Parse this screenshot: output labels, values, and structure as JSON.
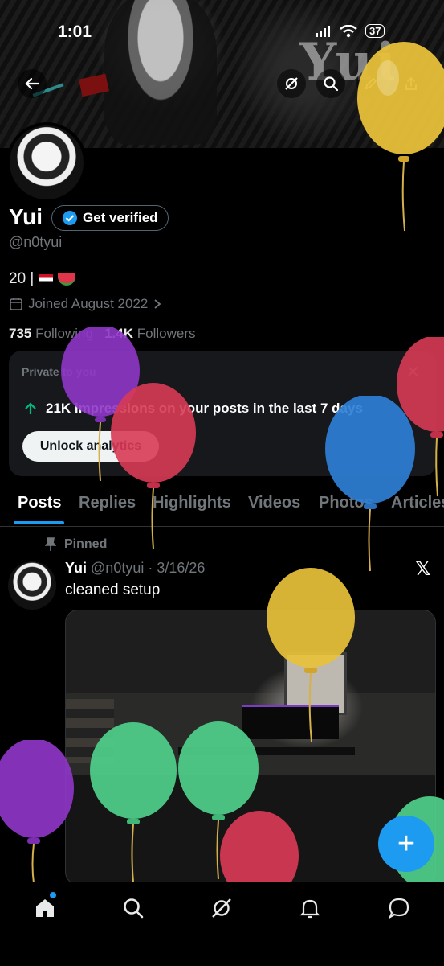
{
  "status_bar": {
    "time": "1:01",
    "battery": "37"
  },
  "banner": {
    "title": "Yui"
  },
  "profile": {
    "name": "Yui",
    "verify_label": "Get verified",
    "handle": "@n0tyui",
    "bio_text": "20 |",
    "joined": "Joined August 2022",
    "following_count": "735",
    "following_label": "Following",
    "followers_count": "1.4K",
    "followers_label": "Followers"
  },
  "analytics_card": {
    "private_label": "Private to you",
    "impressions_count": "21K",
    "impressions_text": "impressions on your posts in the last 7 days",
    "button_label": "Unlock analytics"
  },
  "tabs": [
    {
      "label": "Posts",
      "active": true
    },
    {
      "label": "Replies"
    },
    {
      "label": "Highlights"
    },
    {
      "label": "Videos"
    },
    {
      "label": "Photos"
    },
    {
      "label": "Articles"
    }
  ],
  "post": {
    "pinned_label": "Pinned",
    "author": "Yui",
    "meta": "@n0tyui · 3/16/26",
    "text": "cleaned setup"
  },
  "fab": {
    "label": "+"
  },
  "colors": {
    "accent": "#1d9bf0",
    "background": "#000000",
    "secondary_text": "#71767b",
    "balloon_yellow": "#e8c13a",
    "balloon_purple": "#8e36c8",
    "balloon_red": "#d83a55",
    "balloon_blue": "#2f7fd6",
    "balloon_green": "#4fd08b"
  },
  "icons": [
    "back-arrow-icon",
    "grok-icon",
    "search-icon",
    "edit-icon",
    "share-icon",
    "verified-badge-icon",
    "calendar-icon",
    "chevron-right-icon",
    "arrow-up-icon",
    "close-icon",
    "pin-icon",
    "x-logo-icon",
    "home-icon",
    "grok-nav-icon",
    "bell-icon",
    "messages-icon"
  ]
}
